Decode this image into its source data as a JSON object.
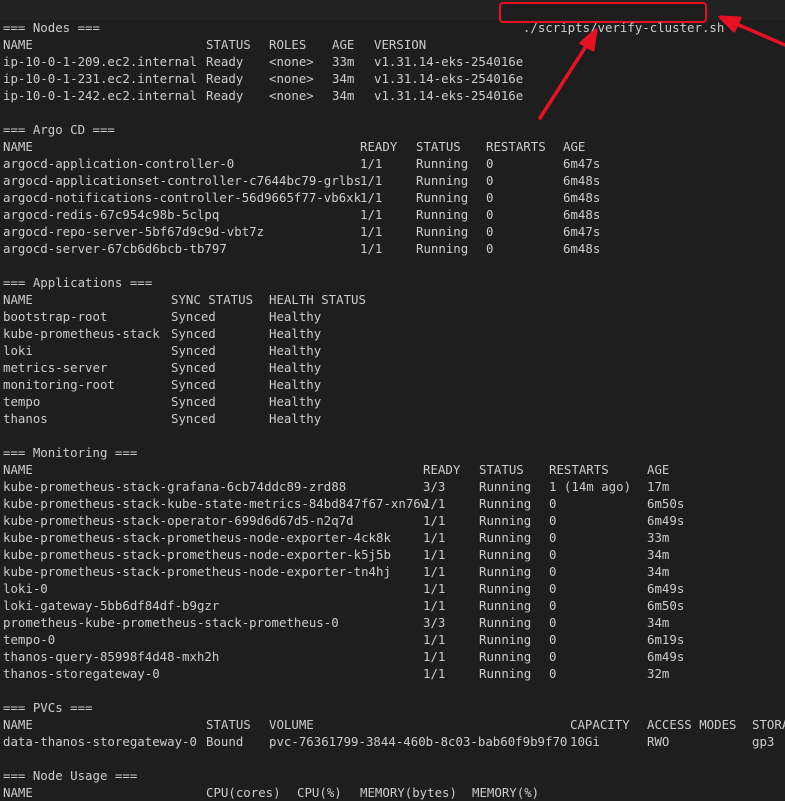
{
  "command": "./scripts/verify-cluster.sh",
  "sections": [
    {
      "title": "=== Nodes ===",
      "cols": [
        0,
        203,
        266,
        329,
        371
      ],
      "headers": [
        "NAME",
        "STATUS",
        "ROLES",
        "AGE",
        "VERSION"
      ],
      "rows": [
        [
          "ip-10-0-1-209.ec2.internal",
          "Ready",
          "<none>",
          "33m",
          "v1.31.14-eks-254016e"
        ],
        [
          "ip-10-0-1-231.ec2.internal",
          "Ready",
          "<none>",
          "34m",
          "v1.31.14-eks-254016e"
        ],
        [
          "ip-10-0-1-242.ec2.internal",
          "Ready",
          "<none>",
          "34m",
          "v1.31.14-eks-254016e"
        ]
      ]
    },
    {
      "title": "=== Argo CD ===",
      "cols": [
        0,
        357,
        413,
        483,
        560
      ],
      "headers": [
        "NAME",
        "READY",
        "STATUS",
        "RESTARTS",
        "AGE"
      ],
      "rows": [
        [
          "argocd-application-controller-0",
          "1/1",
          "Running",
          "0",
          "6m47s"
        ],
        [
          "argocd-applicationset-controller-c7644bc79-grlbs",
          "1/1",
          "Running",
          "0",
          "6m48s"
        ],
        [
          "argocd-notifications-controller-56d9665f77-vb6xk",
          "1/1",
          "Running",
          "0",
          "6m48s"
        ],
        [
          "argocd-redis-67c954c98b-5clpq",
          "1/1",
          "Running",
          "0",
          "6m48s"
        ],
        [
          "argocd-repo-server-5bf67d9c9d-vbt7z",
          "1/1",
          "Running",
          "0",
          "6m47s"
        ],
        [
          "argocd-server-67cb6d6bcb-tb797",
          "1/1",
          "Running",
          "0",
          "6m48s"
        ]
      ]
    },
    {
      "title": "=== Applications ===",
      "cols": [
        0,
        168,
        266
      ],
      "headers": [
        "NAME",
        "SYNC STATUS",
        "HEALTH STATUS"
      ],
      "rows": [
        [
          "bootstrap-root",
          "Synced",
          "Healthy"
        ],
        [
          "kube-prometheus-stack",
          "Synced",
          "Healthy"
        ],
        [
          "loki",
          "Synced",
          "Healthy"
        ],
        [
          "metrics-server",
          "Synced",
          "Healthy"
        ],
        [
          "monitoring-root",
          "Synced",
          "Healthy"
        ],
        [
          "tempo",
          "Synced",
          "Healthy"
        ],
        [
          "thanos",
          "Synced",
          "Healthy"
        ]
      ]
    },
    {
      "title": "=== Monitoring ===",
      "cols": [
        0,
        420,
        476,
        546,
        644
      ],
      "headers": [
        "NAME",
        "READY",
        "STATUS",
        "RESTARTS",
        "AGE"
      ],
      "rows": [
        [
          "kube-prometheus-stack-grafana-6cb74ddc89-zrd88",
          "3/3",
          "Running",
          "1 (14m ago)",
          "17m"
        ],
        [
          "kube-prometheus-stack-kube-state-metrics-84bd847f67-xn76w",
          "1/1",
          "Running",
          "0",
          "6m50s"
        ],
        [
          "kube-prometheus-stack-operator-699d6d67d5-n2q7d",
          "1/1",
          "Running",
          "0",
          "6m49s"
        ],
        [
          "kube-prometheus-stack-prometheus-node-exporter-4ck8k",
          "1/1",
          "Running",
          "0",
          "33m"
        ],
        [
          "kube-prometheus-stack-prometheus-node-exporter-k5j5b",
          "1/1",
          "Running",
          "0",
          "34m"
        ],
        [
          "kube-prometheus-stack-prometheus-node-exporter-tn4hj",
          "1/1",
          "Running",
          "0",
          "34m"
        ],
        [
          "loki-0",
          "1/1",
          "Running",
          "0",
          "6m49s"
        ],
        [
          "loki-gateway-5bb6df84df-b9gzr",
          "1/1",
          "Running",
          "0",
          "6m50s"
        ],
        [
          "prometheus-kube-prometheus-stack-prometheus-0",
          "3/3",
          "Running",
          "0",
          "34m"
        ],
        [
          "tempo-0",
          "1/1",
          "Running",
          "0",
          "6m19s"
        ],
        [
          "thanos-query-85998f4d48-mxh2h",
          "1/1",
          "Running",
          "0",
          "6m49s"
        ],
        [
          "thanos-storegateway-0",
          "1/1",
          "Running",
          "0",
          "32m"
        ]
      ]
    },
    {
      "title": "=== PVCs ===",
      "cols": [
        0,
        203,
        266,
        567,
        644,
        749
      ],
      "headers": [
        "NAME",
        "STATUS",
        "VOLUME",
        "CAPACITY",
        "ACCESS MODES",
        "STORA"
      ],
      "rows": [
        [
          "data-thanos-storegateway-0",
          "Bound",
          "pvc-76361799-3844-460b-8c03-bab60f9b9f70",
          "10Gi",
          "RWO",
          "gp3"
        ]
      ]
    },
    {
      "title": "=== Node Usage ===",
      "cols": [
        0,
        203,
        294,
        357,
        469
      ],
      "headers": [
        "NAME",
        "CPU(cores)",
        "CPU(%)",
        "MEMORY(bytes)",
        "MEMORY(%)"
      ],
      "rows": []
    }
  ],
  "colors": {
    "highlight": "#e81123",
    "text": "#cccccc",
    "background": "#1e1e1e"
  }
}
